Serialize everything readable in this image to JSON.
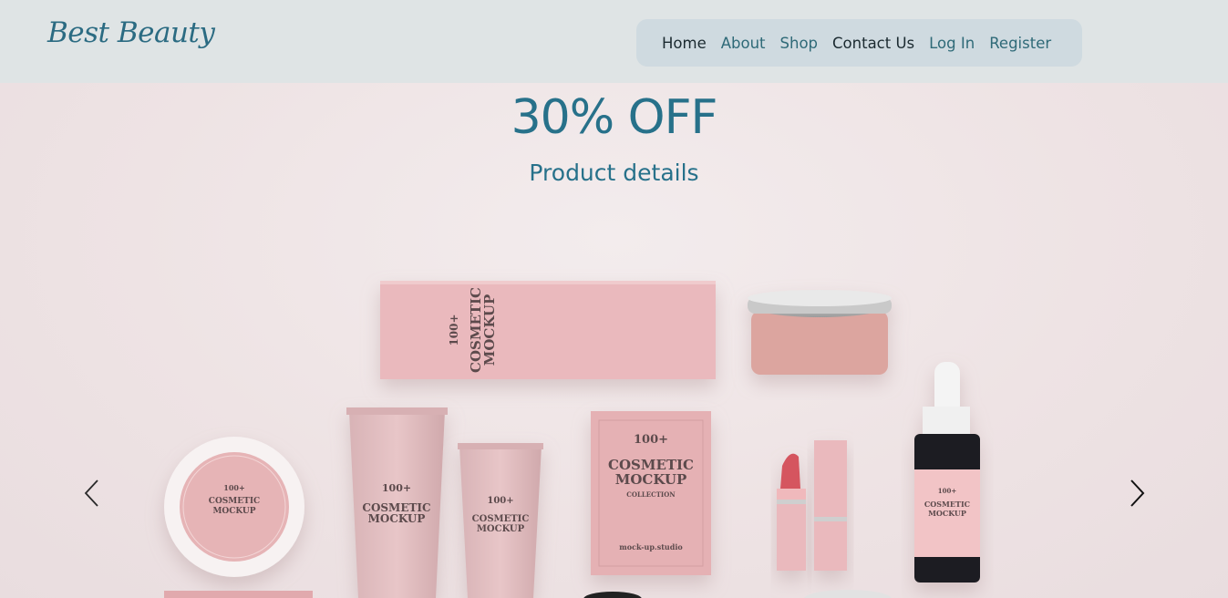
{
  "brand": {
    "logo_text": "Best Beauty"
  },
  "nav": {
    "items": [
      {
        "label": "Home",
        "key": "home"
      },
      {
        "label": "About",
        "key": "about"
      },
      {
        "label": "Shop",
        "key": "shop"
      },
      {
        "label": "Contact Us",
        "key": "contact"
      },
      {
        "label": "Log In",
        "key": "login"
      },
      {
        "label": "Register",
        "key": "register"
      }
    ]
  },
  "hero": {
    "headline": "30% OFF",
    "subheadline": "Product details",
    "prev_icon": "chevron-left-icon",
    "next_icon": "chevron-right-icon"
  },
  "product_image": {
    "box_brand": "100+",
    "box_title_1": "COSMETIC",
    "box_title_2": "MOCKUP",
    "collection": "COLLECTION",
    "studio": "mock-up.studio"
  },
  "colors": {
    "header_bg": "#dfe4e5",
    "nav_bg": "#cfdae0",
    "accent": "#27718a",
    "hero_bg": "#efe5e6",
    "product_pink": "#eab9bd"
  }
}
